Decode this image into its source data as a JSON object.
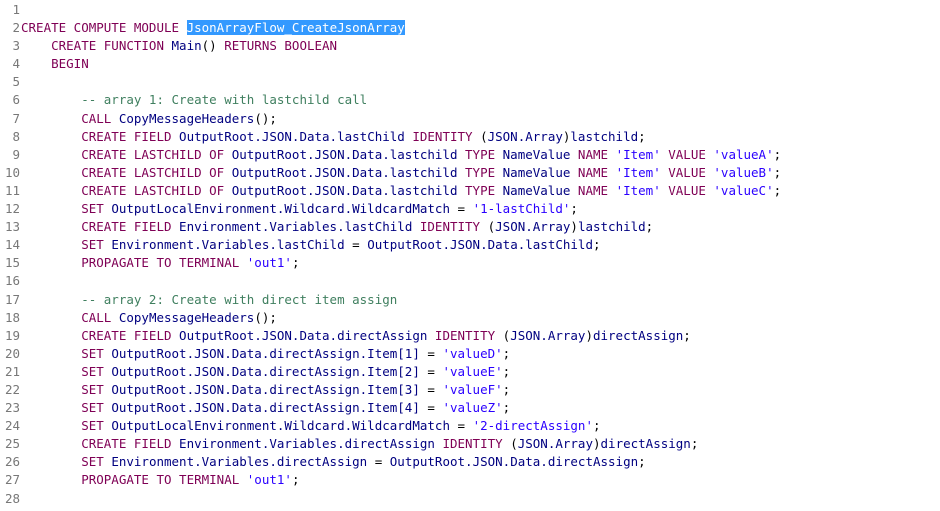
{
  "editor": {
    "lines": [
      {
        "n": "1",
        "tokens": []
      },
      {
        "n": "2",
        "tokens": [
          {
            "t": "CREATE COMPUTE MODULE ",
            "c": "kw"
          },
          {
            "t": "JsonArrayFlow_CreateJsonArray",
            "c": "sel"
          }
        ]
      },
      {
        "n": "3",
        "tokens": [
          {
            "t": "    CREATE FUNCTION ",
            "c": "kw"
          },
          {
            "t": "Main",
            "c": "id"
          },
          {
            "t": "() ",
            "c": "pl"
          },
          {
            "t": "RETURNS BOOLEAN",
            "c": "kw"
          }
        ]
      },
      {
        "n": "4",
        "tokens": [
          {
            "t": "    BEGIN",
            "c": "kw"
          }
        ]
      },
      {
        "n": "5",
        "tokens": []
      },
      {
        "n": "6",
        "tokens": [
          {
            "t": "        -- array 1: Create with lastchild call",
            "c": "cmt"
          }
        ]
      },
      {
        "n": "7",
        "tokens": [
          {
            "t": "        CALL ",
            "c": "kw"
          },
          {
            "t": "CopyMessageHeaders",
            "c": "id"
          },
          {
            "t": "();",
            "c": "pl"
          }
        ]
      },
      {
        "n": "8",
        "tokens": [
          {
            "t": "        CREATE FIELD ",
            "c": "kw"
          },
          {
            "t": "OutputRoot.JSON.Data.lastChild ",
            "c": "id"
          },
          {
            "t": "IDENTITY ",
            "c": "kw"
          },
          {
            "t": "(",
            "c": "pl"
          },
          {
            "t": "JSON.Array",
            "c": "id"
          },
          {
            "t": ")",
            "c": "pl"
          },
          {
            "t": "lastchild",
            "c": "id"
          },
          {
            "t": ";",
            "c": "pl"
          }
        ]
      },
      {
        "n": "9",
        "tokens": [
          {
            "t": "        CREATE LASTCHILD OF ",
            "c": "kw"
          },
          {
            "t": "OutputRoot.JSON.Data.lastchild ",
            "c": "id"
          },
          {
            "t": "TYPE ",
            "c": "kw"
          },
          {
            "t": "NameValue ",
            "c": "id"
          },
          {
            "t": "NAME ",
            "c": "kw"
          },
          {
            "t": "'Item'",
            "c": "str"
          },
          {
            "t": " VALUE ",
            "c": "kw"
          },
          {
            "t": "'valueA'",
            "c": "str"
          },
          {
            "t": ";",
            "c": "pl"
          }
        ]
      },
      {
        "n": "10",
        "tokens": [
          {
            "t": "        CREATE LASTCHILD OF ",
            "c": "kw"
          },
          {
            "t": "OutputRoot.JSON.Data.lastchild ",
            "c": "id"
          },
          {
            "t": "TYPE ",
            "c": "kw"
          },
          {
            "t": "NameValue ",
            "c": "id"
          },
          {
            "t": "NAME ",
            "c": "kw"
          },
          {
            "t": "'Item'",
            "c": "str"
          },
          {
            "t": " VALUE ",
            "c": "kw"
          },
          {
            "t": "'valueB'",
            "c": "str"
          },
          {
            "t": ";",
            "c": "pl"
          }
        ]
      },
      {
        "n": "11",
        "tokens": [
          {
            "t": "        CREATE LASTCHILD OF ",
            "c": "kw"
          },
          {
            "t": "OutputRoot.JSON.Data.lastchild ",
            "c": "id"
          },
          {
            "t": "TYPE ",
            "c": "kw"
          },
          {
            "t": "NameValue ",
            "c": "id"
          },
          {
            "t": "NAME ",
            "c": "kw"
          },
          {
            "t": "'Item'",
            "c": "str"
          },
          {
            "t": " VALUE ",
            "c": "kw"
          },
          {
            "t": "'valueC'",
            "c": "str"
          },
          {
            "t": ";",
            "c": "pl"
          }
        ]
      },
      {
        "n": "12",
        "tokens": [
          {
            "t": "        SET ",
            "c": "kw"
          },
          {
            "t": "OutputLocalEnvironment.Wildcard.WildcardMatch ",
            "c": "id"
          },
          {
            "t": "= ",
            "c": "pl"
          },
          {
            "t": "'1-lastChild'",
            "c": "str"
          },
          {
            "t": ";",
            "c": "pl"
          }
        ]
      },
      {
        "n": "13",
        "tokens": [
          {
            "t": "        CREATE FIELD ",
            "c": "kw"
          },
          {
            "t": "Environment.Variables.lastChild ",
            "c": "id"
          },
          {
            "t": "IDENTITY ",
            "c": "kw"
          },
          {
            "t": "(",
            "c": "pl"
          },
          {
            "t": "JSON.Array",
            "c": "id"
          },
          {
            "t": ")",
            "c": "pl"
          },
          {
            "t": "lastchild",
            "c": "id"
          },
          {
            "t": ";",
            "c": "pl"
          }
        ]
      },
      {
        "n": "14",
        "tokens": [
          {
            "t": "        SET ",
            "c": "kw"
          },
          {
            "t": "Environment.Variables.lastChild ",
            "c": "id"
          },
          {
            "t": "= ",
            "c": "pl"
          },
          {
            "t": "OutputRoot.JSON.Data.lastChild",
            "c": "id"
          },
          {
            "t": ";",
            "c": "pl"
          }
        ]
      },
      {
        "n": "15",
        "tokens": [
          {
            "t": "        PROPAGATE TO TERMINAL ",
            "c": "kw"
          },
          {
            "t": "'out1'",
            "c": "str"
          },
          {
            "t": ";",
            "c": "pl"
          }
        ]
      },
      {
        "n": "16",
        "tokens": []
      },
      {
        "n": "17",
        "tokens": [
          {
            "t": "        -- array 2: Create with direct item assign",
            "c": "cmt"
          }
        ]
      },
      {
        "n": "18",
        "tokens": [
          {
            "t": "        CALL ",
            "c": "kw"
          },
          {
            "t": "CopyMessageHeaders",
            "c": "id"
          },
          {
            "t": "();",
            "c": "pl"
          }
        ]
      },
      {
        "n": "19",
        "tokens": [
          {
            "t": "        CREATE FIELD ",
            "c": "kw"
          },
          {
            "t": "OutputRoot.JSON.Data.directAssign ",
            "c": "id"
          },
          {
            "t": "IDENTITY ",
            "c": "kw"
          },
          {
            "t": "(",
            "c": "pl"
          },
          {
            "t": "JSON.Array",
            "c": "id"
          },
          {
            "t": ")",
            "c": "pl"
          },
          {
            "t": "directAssign",
            "c": "id"
          },
          {
            "t": ";",
            "c": "pl"
          }
        ]
      },
      {
        "n": "20",
        "tokens": [
          {
            "t": "        SET ",
            "c": "kw"
          },
          {
            "t": "OutputRoot.JSON.Data.directAssign.Item[1] ",
            "c": "id"
          },
          {
            "t": "= ",
            "c": "pl"
          },
          {
            "t": "'valueD'",
            "c": "str"
          },
          {
            "t": ";",
            "c": "pl"
          }
        ]
      },
      {
        "n": "21",
        "tokens": [
          {
            "t": "        SET ",
            "c": "kw"
          },
          {
            "t": "OutputRoot.JSON.Data.directAssign.Item[2] ",
            "c": "id"
          },
          {
            "t": "= ",
            "c": "pl"
          },
          {
            "t": "'valueE'",
            "c": "str"
          },
          {
            "t": ";",
            "c": "pl"
          }
        ]
      },
      {
        "n": "22",
        "tokens": [
          {
            "t": "        SET ",
            "c": "kw"
          },
          {
            "t": "OutputRoot.JSON.Data.directAssign.Item[3] ",
            "c": "id"
          },
          {
            "t": "= ",
            "c": "pl"
          },
          {
            "t": "'valueF'",
            "c": "str"
          },
          {
            "t": ";",
            "c": "pl"
          }
        ]
      },
      {
        "n": "23",
        "tokens": [
          {
            "t": "        SET ",
            "c": "kw"
          },
          {
            "t": "OutputRoot.JSON.Data.directAssign.Item[4] ",
            "c": "id"
          },
          {
            "t": "= ",
            "c": "pl"
          },
          {
            "t": "'valueZ'",
            "c": "str"
          },
          {
            "t": ";",
            "c": "pl"
          }
        ]
      },
      {
        "n": "24",
        "tokens": [
          {
            "t": "        SET ",
            "c": "kw"
          },
          {
            "t": "OutputLocalEnvironment.Wildcard.WildcardMatch ",
            "c": "id"
          },
          {
            "t": "= ",
            "c": "pl"
          },
          {
            "t": "'2-directAssign'",
            "c": "str"
          },
          {
            "t": ";",
            "c": "pl"
          }
        ]
      },
      {
        "n": "25",
        "tokens": [
          {
            "t": "        CREATE FIELD ",
            "c": "kw"
          },
          {
            "t": "Environment.Variables.directAssign ",
            "c": "id"
          },
          {
            "t": "IDENTITY ",
            "c": "kw"
          },
          {
            "t": "(",
            "c": "pl"
          },
          {
            "t": "JSON.Array",
            "c": "id"
          },
          {
            "t": ")",
            "c": "pl"
          },
          {
            "t": "directAssign",
            "c": "id"
          },
          {
            "t": ";",
            "c": "pl"
          }
        ]
      },
      {
        "n": "26",
        "tokens": [
          {
            "t": "        SET ",
            "c": "kw"
          },
          {
            "t": "Environment.Variables.directAssign ",
            "c": "id"
          },
          {
            "t": "= ",
            "c": "pl"
          },
          {
            "t": "OutputRoot.JSON.Data.directAssign",
            "c": "id"
          },
          {
            "t": ";",
            "c": "pl"
          }
        ]
      },
      {
        "n": "27",
        "tokens": [
          {
            "t": "        PROPAGATE TO TERMINAL ",
            "c": "kw"
          },
          {
            "t": "'out1'",
            "c": "str"
          },
          {
            "t": ";",
            "c": "pl"
          }
        ]
      },
      {
        "n": "28",
        "tokens": []
      }
    ],
    "selected_line": "2",
    "colors": {
      "keyword": "#7f0055",
      "identifier": "#000080",
      "string": "#2a00ff",
      "comment": "#3f7f5f",
      "selection": "#3399ff",
      "line_number": "#787878"
    }
  }
}
